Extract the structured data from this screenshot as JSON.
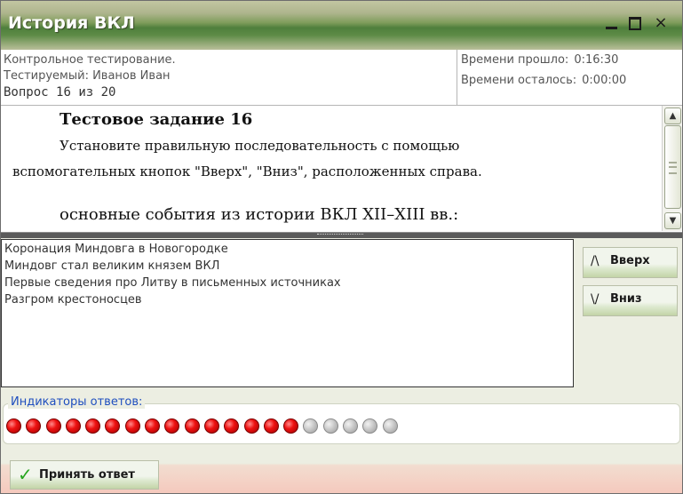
{
  "window": {
    "title": "История ВКЛ",
    "controls": {
      "minimize": "_",
      "maximize": "□",
      "close": "×"
    }
  },
  "info": {
    "test_name": "Контрольное тестирование.",
    "examinee": "Тестируемый: Иванов Иван",
    "question_label": "Вопрос",
    "question_number": "16",
    "question_of": "из",
    "question_total": "20",
    "elapsed_label": "Времени прошло:",
    "elapsed_value": "0:16:30",
    "remaining_label": "Времени осталось:",
    "remaining_value": "0:00:00"
  },
  "task": {
    "title": "Тестовое задание 16",
    "instruction_line1": "Установите правильную последовательность с помощью",
    "instruction_line2": "вспомогательных кнопок \"Вверх\", \"Вниз\", расположенных справа.",
    "subject": "основные события из истории ВКЛ XII–XIII вв.:"
  },
  "answers": [
    "Коронация Миндовга в Новогородке",
    "Миндовг стал великим князем ВКЛ",
    "Первые сведения про Литву в письменных источниках",
    "Разгром крестоносцев"
  ],
  "buttons": {
    "up_icon": "/\\",
    "up_label": "Вверх",
    "down_icon": "\\/",
    "down_label": "Вниз",
    "accept_label": "Принять ответ"
  },
  "indicators": {
    "label": "Индикаторы ответов:",
    "answered": 15,
    "total": 20,
    "answered_color": "#ee1111",
    "unanswered_color": "#c9c9c9"
  }
}
